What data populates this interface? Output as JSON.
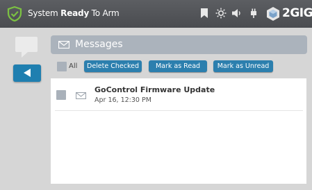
{
  "status": {
    "prefix": "System ",
    "bold": "Ready",
    "suffix": " To Arm",
    "icons": [
      "shield-check-icon",
      "bookmark-icon",
      "sun-icon",
      "speaker-icon",
      "plug-icon"
    ]
  },
  "brand": {
    "name": "2GIG"
  },
  "nav": {
    "icons": [
      "chat-bubble-icon",
      "back-arrow-icon"
    ]
  },
  "messages": {
    "title": "Messages",
    "all_label": "All",
    "actions": {
      "delete_checked": "Delete Checked",
      "mark_read": "Mark as Read",
      "mark_unread": "Mark as Unread"
    },
    "items": [
      {
        "title": "GoControl Firmware Update",
        "date": "Apr 16, 12:30 PM",
        "checked": false
      }
    ]
  },
  "colors": {
    "topbar": "#505256",
    "accent_green": "#7cc242",
    "button_blue": "#2c7fae",
    "header_gray": "#abb3bc",
    "background": "#d6d6d6"
  }
}
